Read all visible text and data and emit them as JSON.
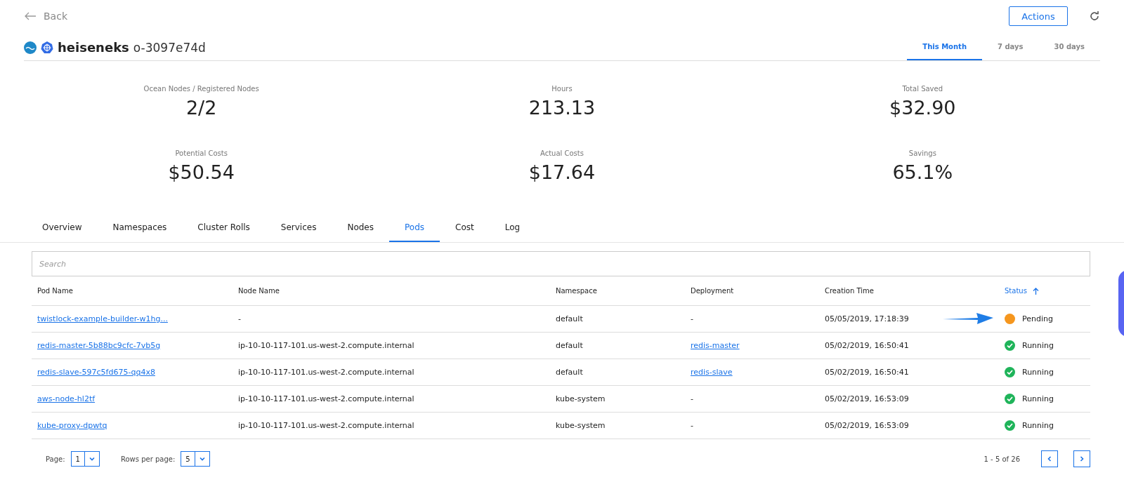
{
  "back": {
    "label": "Back"
  },
  "actions_button": "Actions",
  "cluster": {
    "name": "heiseneks",
    "id": "o-3097e74d"
  },
  "periods": [
    {
      "label": "This Month",
      "selected": true
    },
    {
      "label": "7 days",
      "selected": false
    },
    {
      "label": "30 days",
      "selected": false
    }
  ],
  "stats": [
    {
      "label": "Ocean Nodes / Registered Nodes",
      "value": "2/2"
    },
    {
      "label": "Hours",
      "value": "213.13"
    },
    {
      "label": "Total Saved",
      "value": "$32.90"
    },
    {
      "label": "Potential Costs",
      "value": "$50.54"
    },
    {
      "label": "Actual Costs",
      "value": "$17.64"
    },
    {
      "label": "Savings",
      "value": "65.1%"
    }
  ],
  "tabs": [
    {
      "label": "Overview",
      "selected": false
    },
    {
      "label": "Namespaces",
      "selected": false
    },
    {
      "label": "Cluster Rolls",
      "selected": false
    },
    {
      "label": "Services",
      "selected": false
    },
    {
      "label": "Nodes",
      "selected": false
    },
    {
      "label": "Pods",
      "selected": true
    },
    {
      "label": "Cost",
      "selected": false
    },
    {
      "label": "Log",
      "selected": false
    }
  ],
  "search": {
    "placeholder": "Search"
  },
  "table": {
    "columns": [
      {
        "label": "Pod Name",
        "sorted": false
      },
      {
        "label": "Node Name",
        "sorted": false
      },
      {
        "label": "Namespace",
        "sorted": false
      },
      {
        "label": "Deployment",
        "sorted": false
      },
      {
        "label": "Creation Time",
        "sorted": false
      },
      {
        "label": "Status",
        "sorted": true
      }
    ],
    "rows": [
      {
        "pod": "twistlock-example-builder-w1hg...",
        "node": "-",
        "namespace": "default",
        "deployment": {
          "text": "-",
          "link": false
        },
        "created": "05/05/2019, 17:18:39",
        "status": {
          "kind": "pending",
          "label": "Pending"
        },
        "pointed": true
      },
      {
        "pod": "redis-master-5b88bc9cfc-7vb5g",
        "node": "ip-10-10-117-101.us-west-2.compute.internal",
        "namespace": "default",
        "deployment": {
          "text": "redis-master",
          "link": true
        },
        "created": "05/02/2019, 16:50:41",
        "status": {
          "kind": "running",
          "label": "Running"
        },
        "pointed": false
      },
      {
        "pod": "redis-slave-597c5fd675-qq4x8",
        "node": "ip-10-10-117-101.us-west-2.compute.internal",
        "namespace": "default",
        "deployment": {
          "text": "redis-slave",
          "link": true
        },
        "created": "05/02/2019, 16:50:41",
        "status": {
          "kind": "running",
          "label": "Running"
        },
        "pointed": false
      },
      {
        "pod": "aws-node-hl2tf",
        "node": "ip-10-10-117-101.us-west-2.compute.internal",
        "namespace": "kube-system",
        "deployment": {
          "text": "-",
          "link": false
        },
        "created": "05/02/2019, 16:53:09",
        "status": {
          "kind": "running",
          "label": "Running"
        },
        "pointed": false
      },
      {
        "pod": "kube-proxy-dpwtq",
        "node": "ip-10-10-117-101.us-west-2.compute.internal",
        "namespace": "kube-system",
        "deployment": {
          "text": "-",
          "link": false
        },
        "created": "05/02/2019, 16:53:09",
        "status": {
          "kind": "running",
          "label": "Running"
        },
        "pointed": false
      }
    ]
  },
  "pagination": {
    "page_label": "Page:",
    "page": "1",
    "rows_label": "Rows per page:",
    "rows": "5",
    "range": "1 - 5 of 26"
  }
}
